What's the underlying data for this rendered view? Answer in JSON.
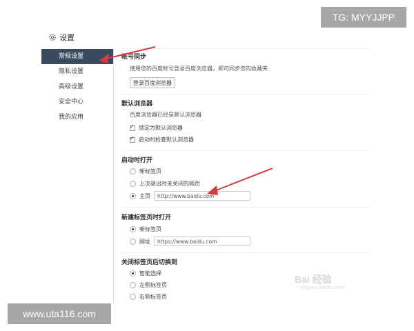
{
  "watermarks": {
    "tg": "TG: MYYJJPP",
    "url": "www.uta116.com",
    "logo": "Bai 经验",
    "logo_sub": "jingyan.baidu.com"
  },
  "header": {
    "title": "设置"
  },
  "sidebar": {
    "items": [
      {
        "label": "常规设置",
        "active": true
      },
      {
        "label": "隐私设置",
        "active": false
      },
      {
        "label": "高级设置",
        "active": false
      },
      {
        "label": "安全中心",
        "active": false
      },
      {
        "label": "我的应用",
        "active": false
      }
    ]
  },
  "account_sync": {
    "title": "帐号同步",
    "desc": "使用您的百度帐号登录百度浏览器，即可同步您的收藏夹",
    "button": "登录百度浏览器"
  },
  "default_browser": {
    "title": "默认浏览器",
    "desc": "百度浏览器已经是默认浏览器",
    "options": [
      {
        "label": "锁定为默认浏览器",
        "checked": true
      },
      {
        "label": "启动时检查默认浏览器",
        "checked": true
      }
    ]
  },
  "on_startup": {
    "title": "启动时打开",
    "options": [
      {
        "label": "新标签页",
        "checked": false
      },
      {
        "label": "上次退出时未关闭的网页",
        "checked": false
      },
      {
        "label": "主页",
        "checked": true
      }
    ],
    "homepage_value": "http://www.baidu.com"
  },
  "new_tab": {
    "title": "新建标签页时打开",
    "options": [
      {
        "label": "新标签页",
        "checked": true
      },
      {
        "label": "网址",
        "checked": false
      }
    ],
    "url_value": "https://www.baidu.com"
  },
  "after_close": {
    "title": "关闭标签页后切换到",
    "options": [
      {
        "label": "智能选择",
        "checked": true
      },
      {
        "label": "左侧标签页",
        "checked": false
      },
      {
        "label": "右侧标签页",
        "checked": false
      }
    ]
  },
  "colors": {
    "accent": "#3a4b5e",
    "arrow": "#d43a3a"
  }
}
